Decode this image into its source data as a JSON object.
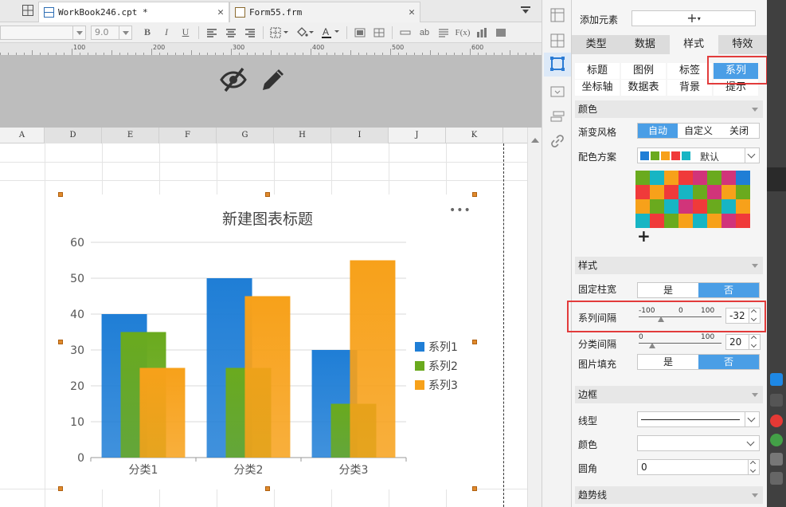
{
  "tabs": [
    {
      "label": "WorkBook246.cpt *",
      "active": true
    },
    {
      "label": "Form55.frm",
      "active": false
    }
  ],
  "toolbar": {
    "font_size": "9.0",
    "bold": "B",
    "italic": "I",
    "underline": "U",
    "abc": "ab",
    "fx": "F(x)"
  },
  "ruler": {
    "marks": [
      "100",
      "200",
      "300",
      "400",
      "500",
      "600"
    ]
  },
  "columns": [
    "A",
    "D",
    "E",
    "F",
    "G",
    "H",
    "I",
    "J",
    "K"
  ],
  "chart_data": {
    "type": "bar",
    "title": "新建图表标题",
    "categories": [
      "分类1",
      "分类2",
      "分类3"
    ],
    "series": [
      {
        "name": "系列1",
        "values": [
          40,
          50,
          30
        ],
        "color": "#1f7ed6"
      },
      {
        "name": "系列2",
        "values": [
          35,
          25,
          15
        ],
        "color": "#6aaa1e"
      },
      {
        "name": "系列3",
        "values": [
          25,
          45,
          55
        ],
        "color": "#f7a11a"
      }
    ],
    "ylim": [
      0,
      60
    ],
    "yticks": [
      "0",
      "10",
      "20",
      "30",
      "40",
      "50",
      "60"
    ],
    "grid": true,
    "legend": "right"
  },
  "panel": {
    "add_element_label": "添加元素",
    "add_symbol": "+",
    "main_tabs": [
      {
        "label": "类型",
        "active": false
      },
      {
        "label": "数据",
        "active": false
      },
      {
        "label": "样式",
        "active": true
      },
      {
        "label": "特效",
        "active": false
      }
    ],
    "sub_tabs": [
      {
        "label": "标题",
        "active": false
      },
      {
        "label": "图例",
        "active": false
      },
      {
        "label": "标签",
        "active": false
      },
      {
        "label": "系列",
        "active": true
      },
      {
        "label": "坐标轴",
        "active": false
      },
      {
        "label": "数据表",
        "active": false
      },
      {
        "label": "背景",
        "active": false
      },
      {
        "label": "提示",
        "active": false
      }
    ],
    "color_section": "颜色",
    "gradient_label": "渐变风格",
    "gradient_options": [
      "自动",
      "自定义",
      "关闭"
    ],
    "gradient_selected": "自动",
    "scheme_label": "配色方案",
    "scheme_value": "默认",
    "scheme_swatches": [
      "#1f7ed6",
      "#6aaa1e",
      "#f7a11a",
      "#f03a3a",
      "#17b5c4"
    ],
    "palette": [
      [
        "#6aaa1e",
        "#17b5c4",
        "#f7a11a",
        "#f03a3a",
        "#d1347a",
        "#6aaa1e",
        "#d1347a",
        "#1f7ed6"
      ],
      [
        "#f03a3a",
        "#f7a11a",
        "#f03a3a",
        "#17b5c4",
        "#6aaa1e",
        "#d1347a",
        "#f7a11a",
        "#6aaa1e"
      ],
      [
        "#f7a11a",
        "#6aaa1e",
        "#17b5c4",
        "#d1347a",
        "#f03a3a",
        "#6aaa1e",
        "#17b5c4",
        "#f7a11a"
      ],
      [
        "#17b5c4",
        "#f03a3a",
        "#6aaa1e",
        "#f7a11a",
        "#17b5c4",
        "#f7a11a",
        "#d1347a",
        "#f03a3a"
      ]
    ],
    "palette_add": "+",
    "style_section": "样式",
    "fixed_width_label": "固定柱宽",
    "yes": "是",
    "no": "否",
    "series_gap_label": "系列间隔",
    "series_gap_marks": [
      "-100",
      "0",
      "100"
    ],
    "series_gap_value": "-32",
    "series_gap_level": -32,
    "category_gap_label": "分类间隔",
    "category_gap_marks": [
      "0",
      "100"
    ],
    "category_gap_value": "20",
    "category_gap_level": 20,
    "image_fill_label": "图片填充",
    "border_section": "边框",
    "line_type_label": "线型",
    "border_color_label": "颜色",
    "corner_label": "圆角",
    "corner_value": "0",
    "trend_section": "趋势线"
  }
}
